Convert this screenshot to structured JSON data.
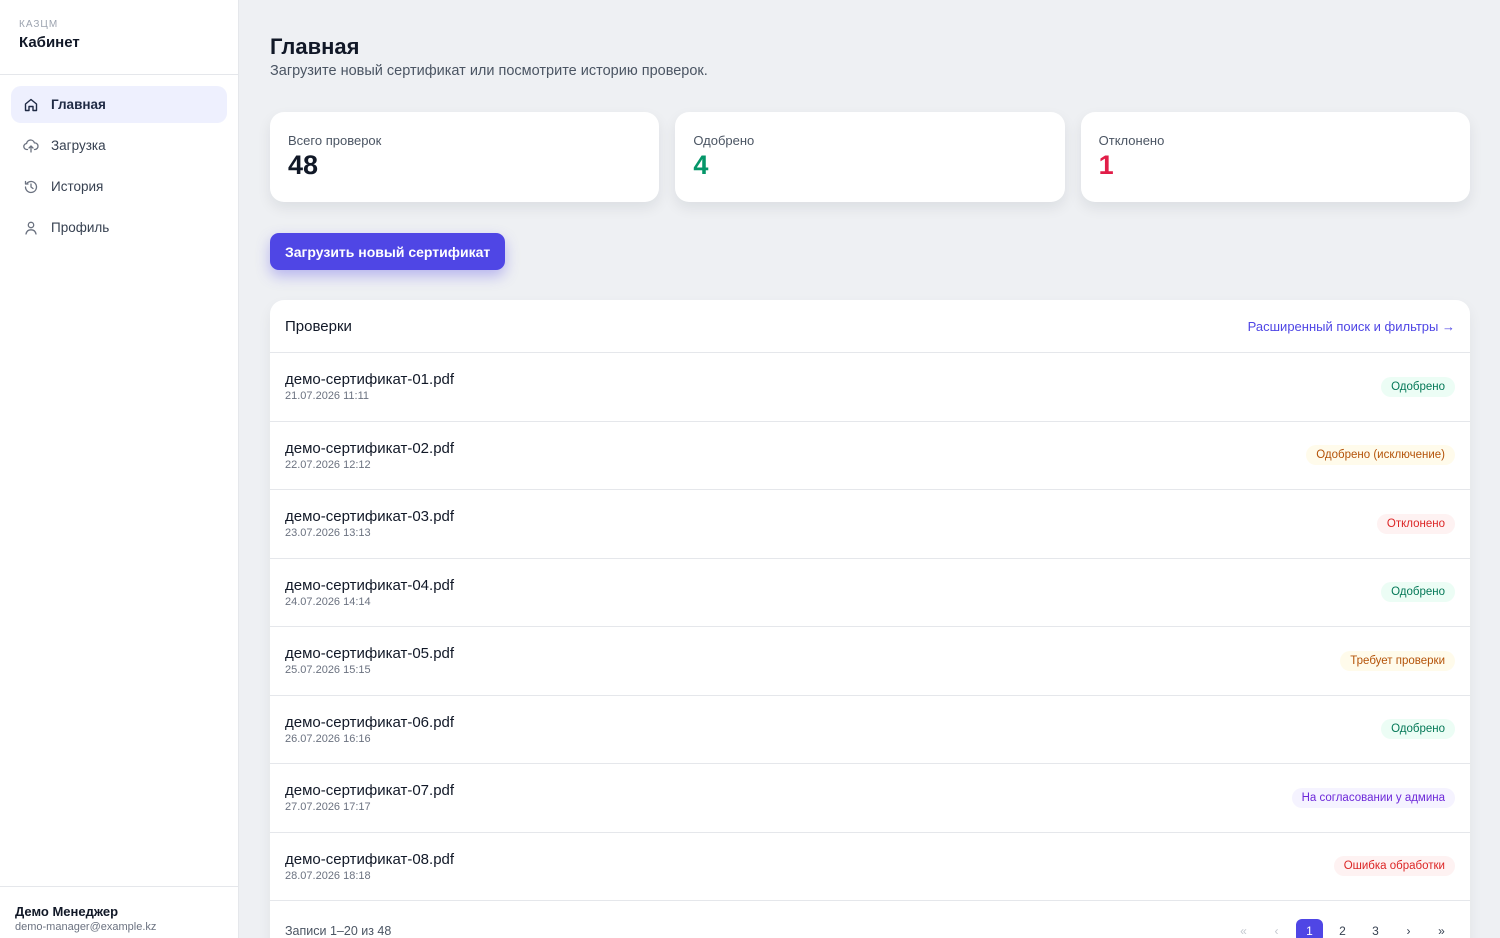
{
  "brand": {
    "small": "КАЗЦМ",
    "title": "Кабинет"
  },
  "sidebar": {
    "items": [
      {
        "label": "Главная",
        "icon": "home-icon",
        "active": true
      },
      {
        "label": "Загрузка",
        "icon": "upload-cloud-icon",
        "active": false
      },
      {
        "label": "История",
        "icon": "history-icon",
        "active": false
      },
      {
        "label": "Профиль",
        "icon": "user-icon",
        "active": false
      }
    ]
  },
  "user": {
    "name": "Демо Менеджер",
    "email": "demo-manager@example.kz"
  },
  "header": {
    "title": "Главная",
    "subtitle": "Загрузите новый сертификат или посмотрите историю проверок."
  },
  "stats": [
    {
      "label": "Всего проверок",
      "value": "48",
      "color": "#111827"
    },
    {
      "label": "Одобрено",
      "value": "4",
      "color": "#059669"
    },
    {
      "label": "Отклонено",
      "value": "1",
      "color": "#e11d48"
    }
  ],
  "upload_button": "Загрузить новый сертификат",
  "checks": {
    "title": "Проверки",
    "filters_link": "Расширенный поиск и фильтры →",
    "rows": [
      {
        "name": "демо-сертификат-01.pdf",
        "date": "21.07.2026 11:11",
        "status": "Одобрено",
        "tone": "green"
      },
      {
        "name": "демо-сертификат-02.pdf",
        "date": "22.07.2026 12:12",
        "status": "Одобрено (исключение)",
        "tone": "amber"
      },
      {
        "name": "демо-сертификат-03.pdf",
        "date": "23.07.2026 13:13",
        "status": "Отклонено",
        "tone": "red"
      },
      {
        "name": "демо-сертификат-04.pdf",
        "date": "24.07.2026 14:14",
        "status": "Одобрено",
        "tone": "green"
      },
      {
        "name": "демо-сертификат-05.pdf",
        "date": "25.07.2026 15:15",
        "status": "Требует проверки",
        "tone": "amber"
      },
      {
        "name": "демо-сертификат-06.pdf",
        "date": "26.07.2026 16:16",
        "status": "Одобрено",
        "tone": "green"
      },
      {
        "name": "демо-сертификат-07.pdf",
        "date": "27.07.2026 17:17",
        "status": "На согласовании у админа",
        "tone": "violet"
      },
      {
        "name": "демо-сертификат-08.pdf",
        "date": "28.07.2026 18:18",
        "status": "Ошибка обработки",
        "tone": "red"
      }
    ],
    "records_label": "Записи 1–20 из 48",
    "pager": {
      "first": "«",
      "prev": "‹",
      "pages": [
        "1",
        "2",
        "3"
      ],
      "current": "1",
      "next": "›",
      "last": "»"
    }
  }
}
